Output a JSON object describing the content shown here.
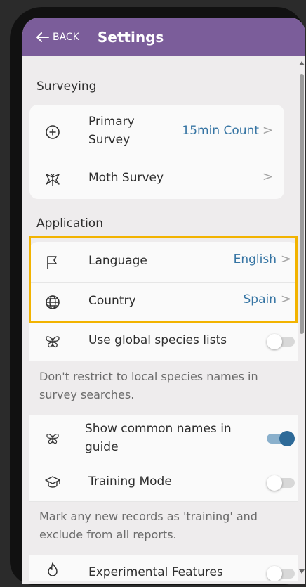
{
  "header": {
    "back_label": "BACK",
    "title": "Settings"
  },
  "sections": {
    "surveying": {
      "title": "Surveying"
    },
    "application": {
      "title": "Application"
    }
  },
  "surveying": {
    "primary_survey": {
      "label_line1": "Primary",
      "label_line2": "Survey",
      "value": "15min Count",
      "icon": "plus-circle-icon"
    },
    "moth_survey": {
      "label": "Moth Survey",
      "icon": "moth-icon"
    }
  },
  "application": {
    "language": {
      "label": "Language",
      "value": "English",
      "icon": "flag-icon"
    },
    "country": {
      "label": "Country",
      "value": "Spain",
      "icon": "globe-icon"
    },
    "global_species": {
      "label": "Use global species lists",
      "icon": "butterfly-icon",
      "enabled": false,
      "note": "Don't restrict to local species names in survey searches."
    },
    "common_names": {
      "label_line1": "Show common names in",
      "label_line2": "guide",
      "icon": "butterfly-icon",
      "enabled": true
    },
    "training_mode": {
      "label": "Training Mode",
      "icon": "graduation-cap-icon",
      "enabled": false,
      "note": "Mark any new records as 'training' and exclude from all reports."
    },
    "experimental": {
      "label": "Experimental Features",
      "icon": "flame-icon",
      "enabled": false
    }
  },
  "chevron": ">",
  "colors": {
    "header": "#7b5d9a",
    "accent": "#3574a3",
    "highlight": "#f2b300",
    "toggle_on": "#2e6a98"
  }
}
